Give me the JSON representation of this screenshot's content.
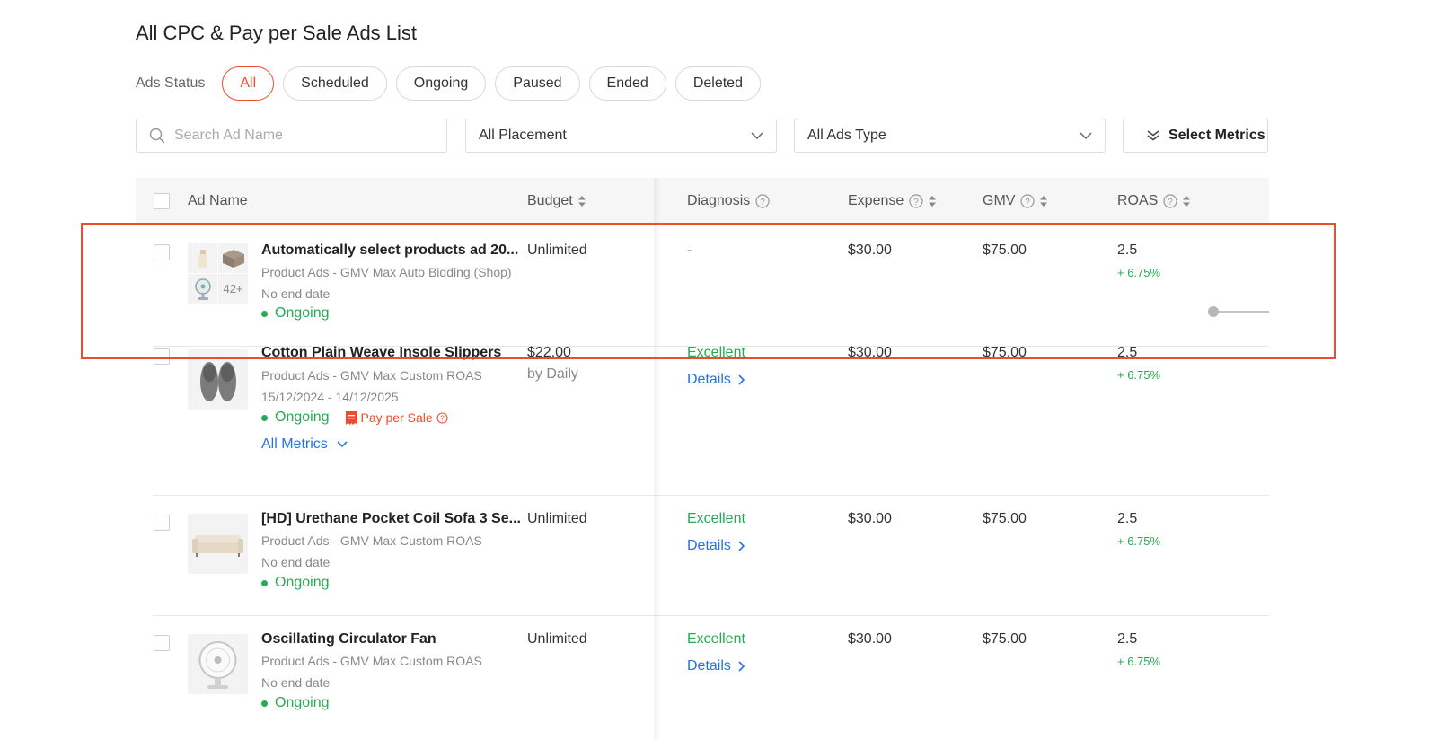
{
  "page": {
    "title": "All CPC & Pay per Sale Ads List"
  },
  "status_filter": {
    "label": "Ads Status",
    "options": [
      "All",
      "Scheduled",
      "Ongoing",
      "Paused",
      "Ended",
      "Deleted"
    ],
    "selected": "All"
  },
  "filters": {
    "search_placeholder": "Search Ad Name",
    "placement_value": "All Placement",
    "ads_type_value": "All Ads Type",
    "select_metrics_label": "Select Metrics"
  },
  "table": {
    "headers": {
      "ad_name": "Ad Name",
      "budget": "Budget",
      "diagnosis": "Diagnosis",
      "expense": "Expense",
      "gmv": "GMV",
      "roas": "ROAS"
    },
    "rows": [
      {
        "name": "Automatically select products ad 20...",
        "type": "Product Ads - GMV Max Auto Bidding (Shop)",
        "date": "No end date",
        "status": "Ongoing",
        "thumb_more": "42+",
        "budget": "Unlimited",
        "diagnosis": "-",
        "expense": "$30.00",
        "gmv": "$75.00",
        "roas": "2.5",
        "roas_delta": "+ 6.75%"
      },
      {
        "name": "Cotton Plain Weave Insole Slippers",
        "type": "Product Ads - GMV Max Custom ROAS",
        "date": "15/12/2024 - 14/12/2025",
        "status": "Ongoing",
        "tag": "Pay per Sale",
        "all_metrics": "All Metrics",
        "budget": "$22.00",
        "budget_period": "by Daily",
        "diagnosis": "Excellent",
        "details": "Details",
        "expense": "$30.00",
        "gmv": "$75.00",
        "roas": "2.5",
        "roas_delta": "+ 6.75%"
      },
      {
        "name": "[HD] Urethane Pocket Coil Sofa 3 Se...",
        "type": "Product Ads - GMV Max Custom ROAS",
        "date": "No end date",
        "status": "Ongoing",
        "budget": "Unlimited",
        "diagnosis": "Excellent",
        "details": "Details",
        "expense": "$30.00",
        "gmv": "$75.00",
        "roas": "2.5",
        "roas_delta": "+ 6.75%"
      },
      {
        "name": "Oscillating Circulator Fan",
        "type": "Product Ads - GMV Max Custom ROAS",
        "date": "No end date",
        "status": "Ongoing",
        "budget": "Unlimited",
        "diagnosis": "Excellent",
        "details": "Details",
        "expense": "$30.00",
        "gmv": "$75.00",
        "roas": "2.5",
        "roas_delta": "+ 6.75%"
      }
    ]
  },
  "colors": {
    "accent": "#ee4d2d",
    "success": "#26aa54",
    "link": "#2673dd"
  }
}
